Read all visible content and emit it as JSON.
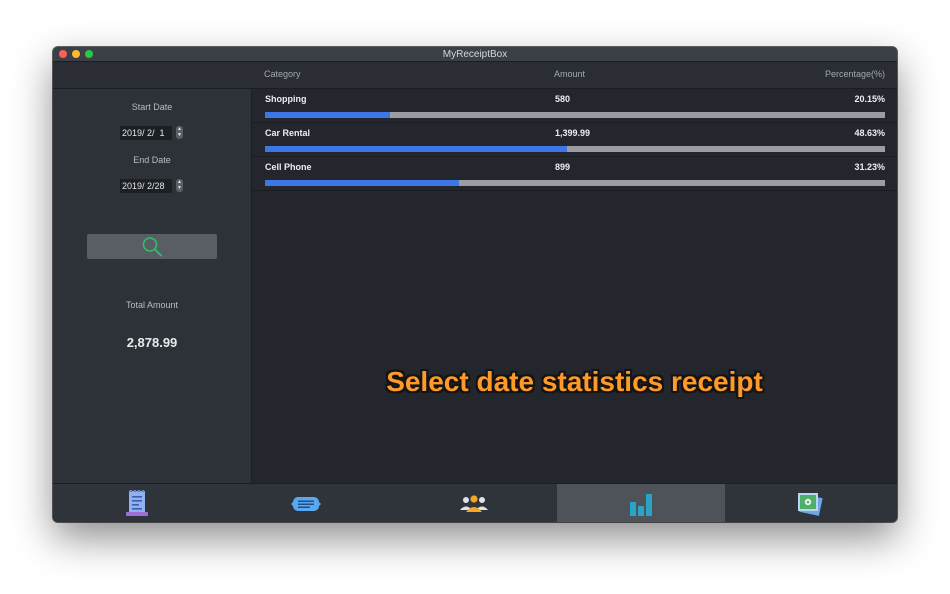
{
  "window": {
    "title": "MyReceiptBox"
  },
  "header": {
    "category": "Category",
    "amount": "Amount",
    "percentage": "Percentage(%)"
  },
  "sidebar": {
    "start_label": "Start Date",
    "start_value": "2019/ 2/  1",
    "end_label": "End Date",
    "end_value": "2019/ 2/28",
    "search_icon": "search-icon",
    "total_label": "Total Amount",
    "total_value": "2,878.99"
  },
  "rows": [
    {
      "category": "Shopping",
      "amount": "580",
      "percentage": "20.15%",
      "fraction": 0.2015
    },
    {
      "category": "Car Rental",
      "amount": "1,399.99",
      "percentage": "48.63%",
      "fraction": 0.4863
    },
    {
      "category": "Cell Phone",
      "amount": "899",
      "percentage": "31.23%",
      "fraction": 0.3123
    }
  ],
  "overlay": {
    "caption": "Select date statistics receipt"
  },
  "tabs": [
    {
      "icon": "receipt-icon",
      "active": false
    },
    {
      "icon": "message-icon",
      "active": false
    },
    {
      "icon": "people-icon",
      "active": false
    },
    {
      "icon": "bar-chart-icon",
      "active": true
    },
    {
      "icon": "photo-settings-icon",
      "active": false
    }
  ],
  "colors": {
    "accent": "#3d76e6",
    "track": "#9a9ea3",
    "caption": "#ff9a2a",
    "search": "#2fbf6a"
  }
}
